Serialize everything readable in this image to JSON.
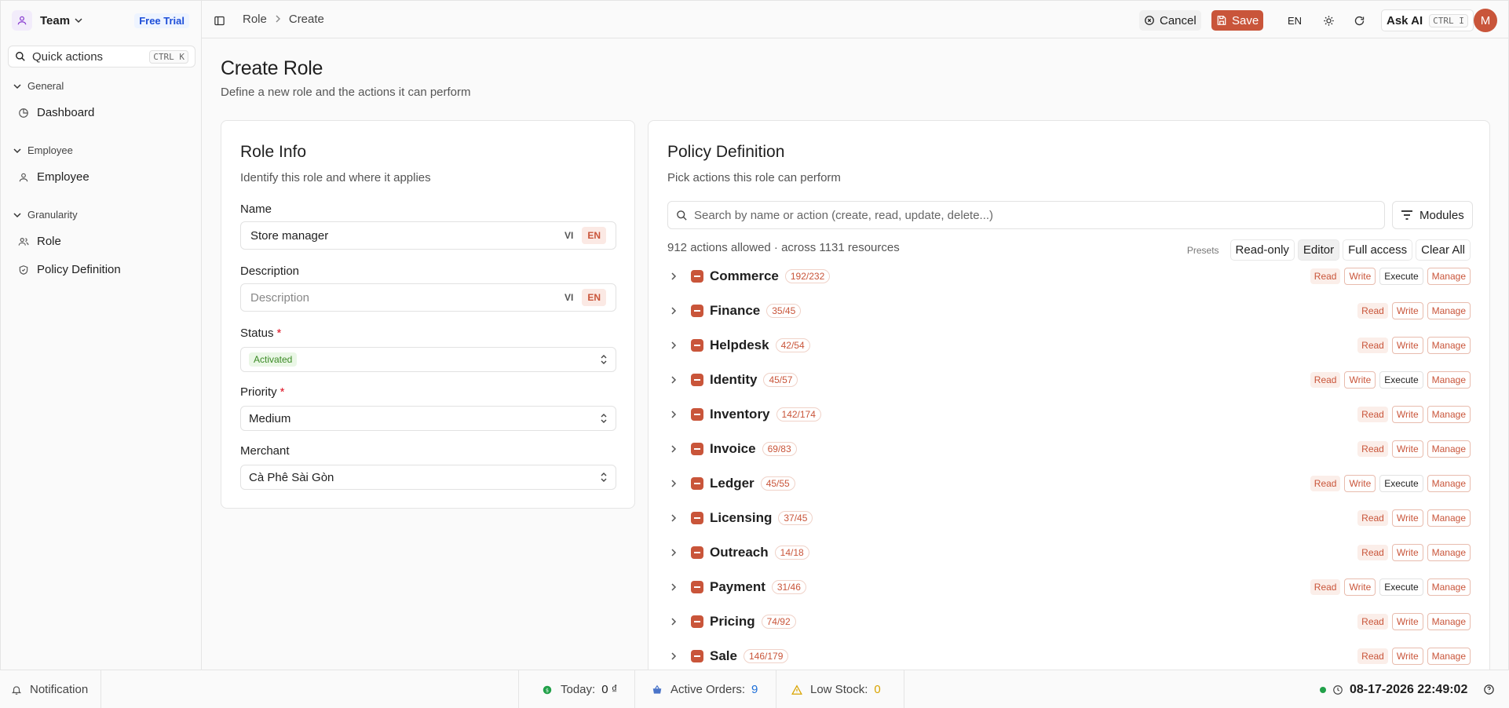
{
  "sidebar": {
    "team_name": "Team",
    "free_trial": "Free Trial",
    "quick_actions": "Quick actions",
    "quick_shortcut": "CTRL K",
    "groups": [
      {
        "label": "General",
        "items": [
          {
            "label": "Dashboard",
            "icon": "dashboard-icon"
          }
        ]
      },
      {
        "label": "Employee",
        "items": [
          {
            "label": "Employee",
            "icon": "user-icon"
          }
        ]
      },
      {
        "label": "Granularity",
        "items": [
          {
            "label": "Role",
            "icon": "users-icon"
          },
          {
            "label": "Policy Definition",
            "icon": "shield-icon"
          }
        ]
      }
    ]
  },
  "topbar": {
    "breadcrumb": [
      "Role",
      "Create"
    ],
    "cancel_label": "Cancel",
    "save_label": "Save",
    "language": "EN",
    "ask_ai_label": "Ask AI",
    "ask_ai_shortcut": "CTRL I",
    "avatar_initial": "M"
  },
  "page": {
    "title": "Create Role",
    "subtitle": "Define a new role and the actions it can perform"
  },
  "role_info": {
    "title": "Role Info",
    "subtitle": "Identify this role and where it applies",
    "name_label": "Name",
    "name_value": "Store manager",
    "description_label": "Description",
    "description_placeholder": "Description",
    "lang_vi": "VI",
    "lang_en": "EN",
    "status_label": "Status",
    "status_value": "Activated",
    "priority_label": "Priority",
    "priority_value": "Medium",
    "merchant_label": "Merchant",
    "merchant_value": "Cà Phê Sài Gòn",
    "required_mark": "*"
  },
  "policy": {
    "title": "Policy Definition",
    "subtitle": "Pick actions this role can perform",
    "search_placeholder": "Search by name or action (create, read, update, delete...)",
    "modules_label": "Modules",
    "summary": "912 actions allowed · across 1131 resources",
    "presets_label": "Presets",
    "presets": [
      "Read-only",
      "Editor",
      "Full access",
      "Clear All"
    ],
    "active_preset": "Editor",
    "modules": [
      {
        "name": "Commerce",
        "count": "192/232",
        "perms": [
          "Read",
          "Write",
          "Execute",
          "Manage"
        ]
      },
      {
        "name": "Finance",
        "count": "35/45",
        "perms": [
          "Read",
          "Write",
          "Manage"
        ]
      },
      {
        "name": "Helpdesk",
        "count": "42/54",
        "perms": [
          "Read",
          "Write",
          "Manage"
        ]
      },
      {
        "name": "Identity",
        "count": "45/57",
        "perms": [
          "Read",
          "Write",
          "Execute",
          "Manage"
        ]
      },
      {
        "name": "Inventory",
        "count": "142/174",
        "perms": [
          "Read",
          "Write",
          "Manage"
        ]
      },
      {
        "name": "Invoice",
        "count": "69/83",
        "perms": [
          "Read",
          "Write",
          "Manage"
        ]
      },
      {
        "name": "Ledger",
        "count": "45/55",
        "perms": [
          "Read",
          "Write",
          "Execute",
          "Manage"
        ]
      },
      {
        "name": "Licensing",
        "count": "37/45",
        "perms": [
          "Read",
          "Write",
          "Manage"
        ]
      },
      {
        "name": "Outreach",
        "count": "14/18",
        "perms": [
          "Read",
          "Write",
          "Manage"
        ]
      },
      {
        "name": "Payment",
        "count": "31/46",
        "perms": [
          "Read",
          "Write",
          "Execute",
          "Manage"
        ]
      },
      {
        "name": "Pricing",
        "count": "74/92",
        "perms": [
          "Read",
          "Write",
          "Manage"
        ]
      },
      {
        "name": "Sale",
        "count": "146/179",
        "perms": [
          "Read",
          "Write",
          "Manage"
        ]
      }
    ]
  },
  "footer": {
    "notification": "Notification",
    "today_label": "Today:",
    "today_value": "0 ₫",
    "orders_label": "Active Orders:",
    "orders_value": "9",
    "stock_label": "Low Stock:",
    "stock_value": "0",
    "datetime": "08-17-2026 22:49:02"
  },
  "colors": {
    "accent": "#c9553a",
    "orders_value": "#1d6fd8",
    "stock_value": "#d9a400",
    "online": "#22a14a"
  }
}
